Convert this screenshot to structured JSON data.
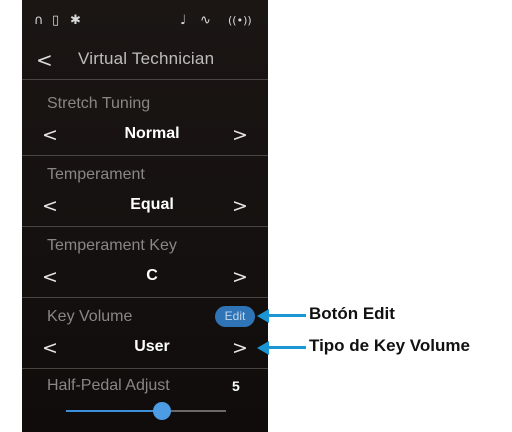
{
  "status_bar": {
    "headphones_icon": "∩",
    "usb_icon": "▯",
    "bluetooth_icon": "✱",
    "metronome_icon": "♩",
    "sound_icon": "∿",
    "wireless_icon": "((•))"
  },
  "header": {
    "back": "<",
    "title": "Virtual Technician"
  },
  "settings": [
    {
      "label": "Stretch Tuning",
      "value": "Normal",
      "prev": "<",
      "next": ">"
    },
    {
      "label": "Temperament",
      "value": "Equal",
      "prev": "<",
      "next": ">"
    },
    {
      "label": "Temperament Key",
      "value": "C",
      "prev": "<",
      "next": ">"
    },
    {
      "label": "Key Volume",
      "value": "User",
      "prev": "<",
      "next": ">",
      "edit": "Edit"
    }
  ],
  "half_pedal": {
    "label": "Half-Pedal Adjust",
    "value": "5",
    "level": 0.6
  },
  "callouts": {
    "edit": "Botón Edit",
    "key_volume": "Tipo de Key Volume"
  },
  "colors": {
    "accent": "#1a96d4",
    "edit_button": "#2f74b6",
    "slider": "#4d9be3"
  }
}
